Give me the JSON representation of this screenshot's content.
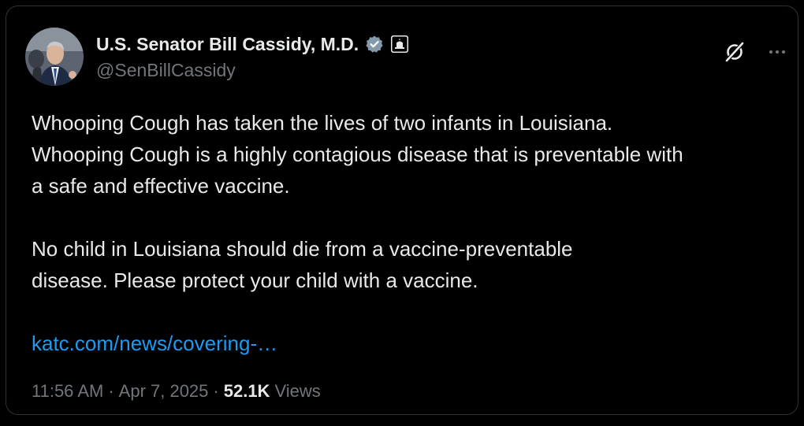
{
  "author": {
    "display_name": "U.S. Senator Bill Cassidy, M.D.",
    "handle": "@SenBillCassidy",
    "verified_icon": "verified-badge-icon",
    "affiliation_icon": "government-building-icon"
  },
  "tweet": {
    "lines_para1": [
      "Whooping Cough has taken the lives of two infants in Louisiana.",
      "Whooping Cough is a highly contagious disease that is preventable with",
      "a safe and effective vaccine."
    ],
    "lines_para2": [
      "No child in Louisiana should die from a vaccine-preventable",
      "disease. Please protect your child with a vaccine."
    ],
    "link": "katc.com/news/covering-…"
  },
  "meta": {
    "time": "11:56 AM",
    "separator": "·",
    "date": "Apr 7, 2025",
    "views_count": "52.1K",
    "views_label": "Views"
  },
  "colors": {
    "background": "#000000",
    "text": "#e7e9ea",
    "muted": "#71767b",
    "link": "#1d9bf0",
    "verified": "#829aab"
  }
}
